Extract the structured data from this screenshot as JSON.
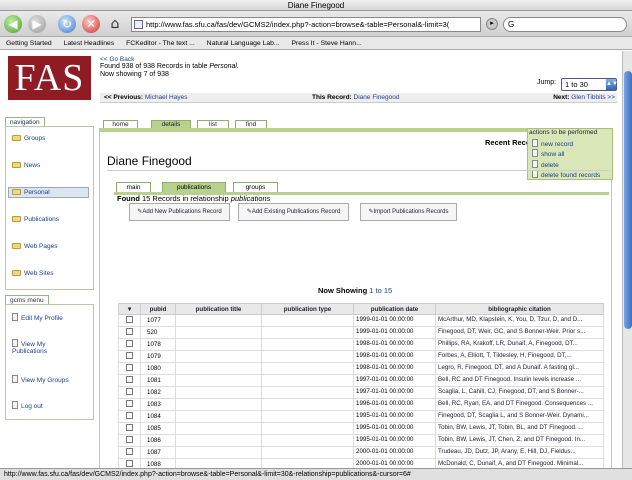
{
  "window": {
    "title": "Diane Finegood"
  },
  "toolbar": {
    "url": "http://www.fas.sfu.ca/fas/dev/GCMS2/index.php?-action=browse&-table=Personal&-limit=3(",
    "search": "G"
  },
  "bookmarks": [
    "Getting Started",
    "Latest Headlines",
    "FCKeditor - The text ...",
    "Natural Language Lab...",
    "Press It - Steve Hann..."
  ],
  "header": {
    "logo": "FAS",
    "go_back": "<< Go Back",
    "found_prefix": "Found 938 of 938 Records in table ",
    "found_table": "Personal.",
    "showing": "Now showing 7 of 938",
    "jump_label": "Jump:",
    "jump_value": "1 to 30"
  },
  "prevnext": {
    "prev_label": "<< Previous:",
    "prev_name": "Michael Hayes",
    "this_label": "This Record:",
    "this_name": "Diane Finegood",
    "next_label": "Next:",
    "next_name": "Glen Tibbits >>"
  },
  "sidebar": {
    "nav_title": "navigation",
    "nav_items": [
      "Groups",
      "News",
      "Personal",
      "Publications",
      "Web Pages",
      "Web Sites"
    ],
    "menu_title": "gcms menu",
    "menu_items": [
      "Edit My Profile",
      "View My Publications",
      "View My Groups",
      "Log out"
    ]
  },
  "tabs": [
    "home",
    "details",
    "list",
    "find"
  ],
  "actions": {
    "title": "actions to be performed",
    "items": [
      "new record",
      "show all",
      "delete",
      "delete found records"
    ]
  },
  "recent": "Recent Reco",
  "record_name": "Diane Finegood",
  "subtabs": [
    "main",
    "publications",
    "groups"
  ],
  "relationship": {
    "found_prefix": "Found",
    "found_mid": " 15 Records in relationship ",
    "relationship_name": "publications"
  },
  "buttons": {
    "add_new": "Add New Publications Record",
    "add_existing": "Add Existing Publications Record",
    "import": "Import Publications Records"
  },
  "now_showing": {
    "label": "Now Showing",
    "range": "1 to 15"
  },
  "table": {
    "headers": [
      "pubid",
      "publication title",
      "publication type",
      "publication date",
      "bibliographic citation"
    ],
    "rows": [
      {
        "pubid": "1077",
        "title": "",
        "type": "",
        "date": "1999-01-01 00:00:00",
        "citation": "McArthur, MD, Klapstein, K, You, D, Tzur, D, and D..."
      },
      {
        "pubid": "520",
        "title": "",
        "type": "",
        "date": "1999-01-01 00:00:00",
        "citation": "Finegood, DT, Weir, GC, and S Bonner-Weir. Prior s..."
      },
      {
        "pubid": "1078",
        "title": "",
        "type": "",
        "date": "1998-01-01 00:00:00",
        "citation": "Phillips, RA, Krakoff, LR, Dunaif, A, Finegood, DT..."
      },
      {
        "pubid": "1079",
        "title": "",
        "type": "",
        "date": "1998-01-01 00:00:00",
        "citation": "Forbes, A, Elliott, T, Tildesley, H, Finegood, DT,..."
      },
      {
        "pubid": "1080",
        "title": "",
        "type": "",
        "date": "1998-01-01 00:00:00",
        "citation": "Legro, R, Finegood, DT, and A Dunaif. A fasting gl..."
      },
      {
        "pubid": "1081",
        "title": "",
        "type": "",
        "date": "1997-01-01 00:00:00",
        "citation": "Bell, RC and DT Finegood. Insulin levels increase ..."
      },
      {
        "pubid": "1082",
        "title": "",
        "type": "",
        "date": "1997-01-01 00:00:00",
        "citation": "Scaglia, L, Cahill, CJ, Finegood, DT, and S Bonner-..."
      },
      {
        "pubid": "1083",
        "title": "",
        "type": "",
        "date": "1996-01-01 00:00:00",
        "citation": "Bell, RC, Ryan, EA, and DT Finegood. Consequences ..."
      },
      {
        "pubid": "1084",
        "title": "",
        "type": "",
        "date": "1995-01-01 00:00:00",
        "citation": "Finegood, DT, Scaglia L, and S Bonner-Weir. Dynami..."
      },
      {
        "pubid": "1085",
        "title": "",
        "type": "",
        "date": "1995-01-01 00:00:00",
        "citation": "Tobin, BW, Lewis, JT, Tobin, BL, and DT Finegood. ..."
      },
      {
        "pubid": "1086",
        "title": "",
        "type": "",
        "date": "1995-01-01 00:00:00",
        "citation": "Tobin, BW, Lewis, JT, Chen, Z, and DT Finegood. In..."
      },
      {
        "pubid": "1087",
        "title": "",
        "type": "",
        "date": "2000-01-01 00:00:00",
        "citation": "Trudeau, JD, Dutz, JP, Arany, E, Hill, DJ, Fieldus..."
      },
      {
        "pubid": "1088",
        "title": "",
        "type": "",
        "date": "2000-01-01 00:00:00",
        "citation": "McDonald, C, Dunaif, A, and DT Finegood. Minimal..."
      }
    ]
  },
  "status": "http://www.fas.sfu.ca/fas/dev/GCMS2/index.php?-action=browse&-table=Personal&-limit=30&-relationship=publications&-cursor=6#"
}
